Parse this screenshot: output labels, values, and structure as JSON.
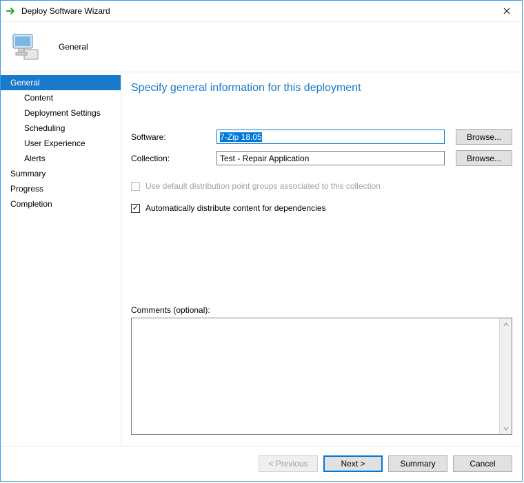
{
  "window": {
    "title": "Deploy Software Wizard"
  },
  "header": {
    "page_title": "General"
  },
  "sidebar": {
    "items": [
      {
        "label": "General",
        "sub": false,
        "selected": true
      },
      {
        "label": "Content",
        "sub": true,
        "selected": false
      },
      {
        "label": "Deployment Settings",
        "sub": true,
        "selected": false
      },
      {
        "label": "Scheduling",
        "sub": true,
        "selected": false
      },
      {
        "label": "User Experience",
        "sub": true,
        "selected": false
      },
      {
        "label": "Alerts",
        "sub": true,
        "selected": false
      },
      {
        "label": "Summary",
        "sub": false,
        "selected": false
      },
      {
        "label": "Progress",
        "sub": false,
        "selected": false
      },
      {
        "label": "Completion",
        "sub": false,
        "selected": false
      }
    ]
  },
  "main": {
    "heading": "Specify general information for this deployment",
    "software_label": "Software:",
    "software_value": "7-Zip 18.05",
    "collection_label": "Collection:",
    "collection_value": "Test - Repair Application",
    "browse_label": "Browse...",
    "check1_label": "Use default distribution point groups associated to this collection",
    "check1_checked": false,
    "check1_enabled": false,
    "check2_label": "Automatically distribute content for dependencies",
    "check2_checked": true,
    "check2_enabled": true,
    "comments_label": "Comments (optional):",
    "comments_value": ""
  },
  "footer": {
    "previous": "< Previous",
    "next": "Next >",
    "summary": "Summary",
    "cancel": "Cancel"
  }
}
